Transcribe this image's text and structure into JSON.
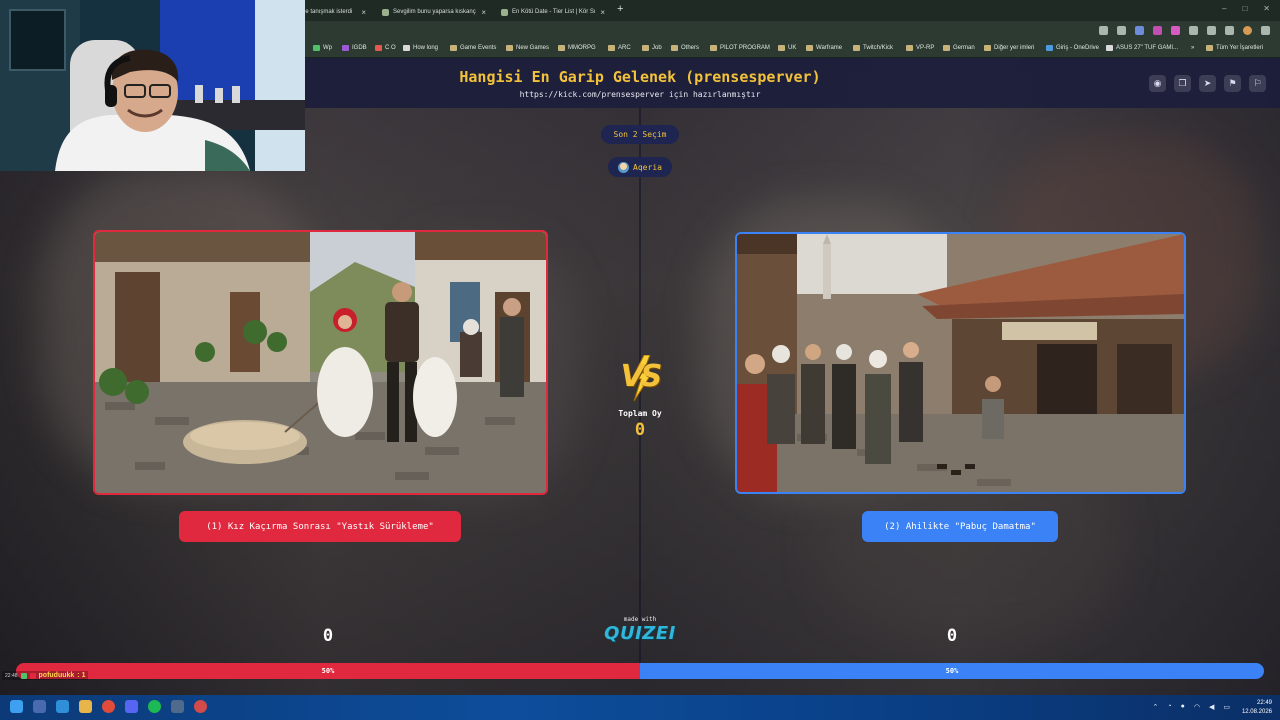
{
  "browser": {
    "tabs": [
      {
        "label": "le tanışmak isterdi",
        "active": false
      },
      {
        "label": "Sevgilim bunu yaparsa kıskanç",
        "active": false
      },
      {
        "label": "En Kötü Date - Tier List | Kör Sı",
        "active": false
      }
    ],
    "new_tab_glyph": "+",
    "window_controls": [
      "–",
      "□",
      "✕"
    ],
    "bookmarks": [
      "Wp",
      "IGDB",
      "C O",
      "How long",
      "Game Events",
      "New Games",
      "MMORPG",
      "ARC",
      "Job",
      "Others",
      "PILOT PROGRAM",
      "UK",
      "Warframe",
      "Twitch/Kick",
      "VP-RP",
      "German",
      "Diğer yer imleri",
      "Giriş - OneDrive",
      "ASUS 27\" TUF GAMI...",
      "»",
      "Tüm Yer İşaretleri"
    ]
  },
  "quiz": {
    "title": "Hangisi En Garip Gelenek (prensesperver)",
    "subtitle": "https://kick.com/prensesperver için hazırlanmıştır",
    "round_label": "Son 2 Seçim",
    "user_label": "Aqeria",
    "header_icons": [
      "eye-icon",
      "copy-icon",
      "send-icon",
      "flag-icon",
      "report-icon"
    ],
    "left_option": {
      "label": "(1) Kız Kaçırma Sonrası \"Yastık Sürükleme\"",
      "votes": "0",
      "percent": "50%",
      "color": "#e0293f"
    },
    "right_option": {
      "label": "(2) Ahilikte \"Pabuç Damatma\"",
      "votes": "0",
      "percent": "50%",
      "color": "#3b82f6"
    },
    "vs_label": "VS",
    "total_votes_label": "Toplam Oy",
    "total_votes": "0",
    "made_with": "made with",
    "brand": "QUIZEI",
    "vote_share": {
      "left": 0.5,
      "right": 0.5
    }
  },
  "chat": {
    "time": "22:48",
    "user": "pofuduukk",
    "message": ": 1"
  },
  "taskbar": {
    "time": "22:49",
    "date": "12.08.2026"
  },
  "colors": {
    "accent_yellow": "#f3c23a",
    "header_bg": "#1c1e3c",
    "red": "#e0293f",
    "blue": "#3b82f6"
  }
}
